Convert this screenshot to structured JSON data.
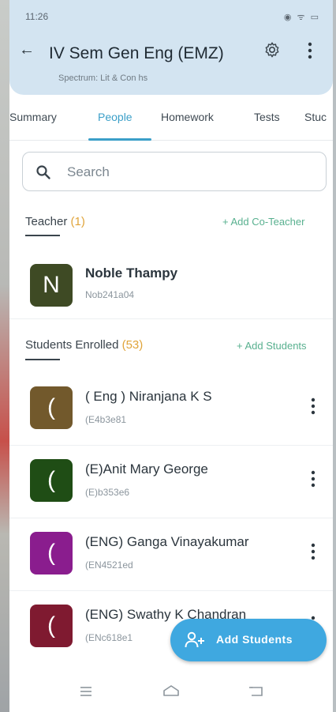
{
  "status_bar": {
    "time": "11:26",
    "icons_right": "◉ ᯤ ▭"
  },
  "header": {
    "back_icon": "arrow-left",
    "title": "IV Sem Gen Eng (EMZ)",
    "subtitle": "Spectrum: Lit & Con hs"
  },
  "tabs": [
    {
      "label": "Summary",
      "active": false
    },
    {
      "label": "People",
      "active": true
    },
    {
      "label": "Homework",
      "active": false
    },
    {
      "label": "Tests",
      "active": false
    },
    {
      "label": "Stuc",
      "active": false
    }
  ],
  "search": {
    "placeholder": "Search"
  },
  "teacher_section": {
    "label": "Teacher",
    "count": "(1)",
    "action": "+ Add Co-Teacher"
  },
  "teachers": [
    {
      "initial": "N",
      "name": "Noble  Thampy",
      "id": "Nob241a04",
      "color": "#3e4a24"
    }
  ],
  "students_section": {
    "label": "Students Enrolled",
    "count": "(53)",
    "action": "+ Add Students"
  },
  "students": [
    {
      "initial": "(",
      "name": "( Eng ) Niranjana K S",
      "id": "(E4b3e81",
      "color": "#72592c"
    },
    {
      "initial": "(",
      "name": "(E)Anit Mary George",
      "id": "(E)b353e6",
      "color": "#1f4d15"
    },
    {
      "initial": "(",
      "name": "(ENG) Ganga Vinayakumar",
      "id": "(EN4521ed",
      "color": "#8a1d8e"
    },
    {
      "initial": "(",
      "name": "(ENG) Swathy K Chandran",
      "id": "(ENc618e1",
      "color": "#7f1a30"
    }
  ],
  "fab": {
    "label": "Add Students"
  }
}
